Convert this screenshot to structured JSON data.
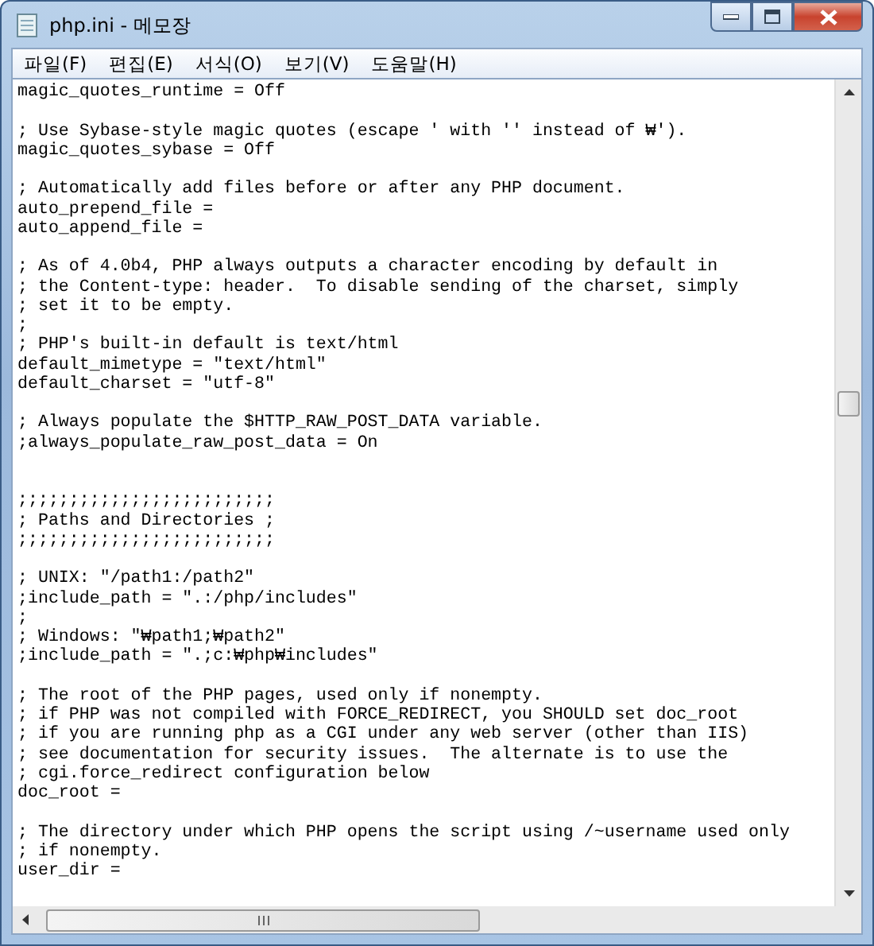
{
  "window": {
    "title": "php.ini - 메모장"
  },
  "menu": [
    "파일(F)",
    "편집(E)",
    "서식(O)",
    "보기(V)",
    "도움말(H)"
  ],
  "lines": [
    {
      "kind": "text",
      "text": "magic_quotes_runtime = Off"
    },
    {
      "kind": "blank"
    },
    {
      "kind": "text",
      "text": "; Use Sybase-style magic quotes (escape ' with '' instead of ₩')."
    },
    {
      "kind": "text",
      "text": "magic_quotes_sybase = Off"
    },
    {
      "kind": "blank"
    },
    {
      "kind": "text",
      "text": "; Automatically add files before or after any PHP document."
    },
    {
      "kind": "text",
      "text": "auto_prepend_file ="
    },
    {
      "kind": "text",
      "text": "auto_append_file ="
    },
    {
      "kind": "blank"
    },
    {
      "kind": "text",
      "text": "; As of 4.0b4, PHP always outputs a character encoding by default in"
    },
    {
      "kind": "text",
      "text": "; the Content-type: header.  To disable sending of the charset, simply"
    },
    {
      "kind": "text",
      "text": "; set it to be empty."
    },
    {
      "kind": "text",
      "text": ";"
    },
    {
      "kind": "text",
      "text": "; PHP's built-in default is text/html"
    },
    {
      "kind": "text",
      "text": "default_mimetype = \"text/html\""
    },
    {
      "kind": "text",
      "text": "default_charset = \"utf-8\""
    },
    {
      "kind": "blank"
    },
    {
      "kind": "text",
      "text": "; Always populate the $HTTP_RAW_POST_DATA variable."
    },
    {
      "kind": "text",
      "text": ";always_populate_raw_post_data = On"
    },
    {
      "kind": "blank"
    },
    {
      "kind": "blank"
    },
    {
      "kind": "text",
      "text": ";;;;;;;;;;;;;;;;;;;;;;;;;"
    },
    {
      "kind": "text",
      "text": "; Paths and Directories ;"
    },
    {
      "kind": "text",
      "text": ";;;;;;;;;;;;;;;;;;;;;;;;;"
    },
    {
      "kind": "blank"
    },
    {
      "kind": "text",
      "text": "; UNIX: \"/path1:/path2\""
    },
    {
      "kind": "text",
      "text": ";include_path = \".:/php/includes\""
    },
    {
      "kind": "text",
      "text": ";"
    },
    {
      "kind": "text",
      "text": "; Windows: \"₩path1;₩path2\""
    },
    {
      "kind": "text",
      "text": ";include_path = \".;c:₩php₩includes\""
    },
    {
      "kind": "blank"
    },
    {
      "kind": "text",
      "text": "; The root of the PHP pages, used only if nonempty."
    },
    {
      "kind": "text",
      "text": "; if PHP was not compiled with FORCE_REDIRECT, you SHOULD set doc_root"
    },
    {
      "kind": "text",
      "text": "; if you are running php as a CGI under any web server (other than IIS)"
    },
    {
      "kind": "text",
      "text": "; see documentation for security issues.  The alternate is to use the"
    },
    {
      "kind": "text",
      "text": "; cgi.force_redirect configuration below"
    },
    {
      "kind": "text",
      "text": "doc_root ="
    },
    {
      "kind": "blank"
    },
    {
      "kind": "text",
      "text": "; The directory under which PHP opens the script using /~username used only"
    },
    {
      "kind": "text",
      "text": "; if nonempty."
    },
    {
      "kind": "text",
      "text": "user_dir ="
    }
  ]
}
